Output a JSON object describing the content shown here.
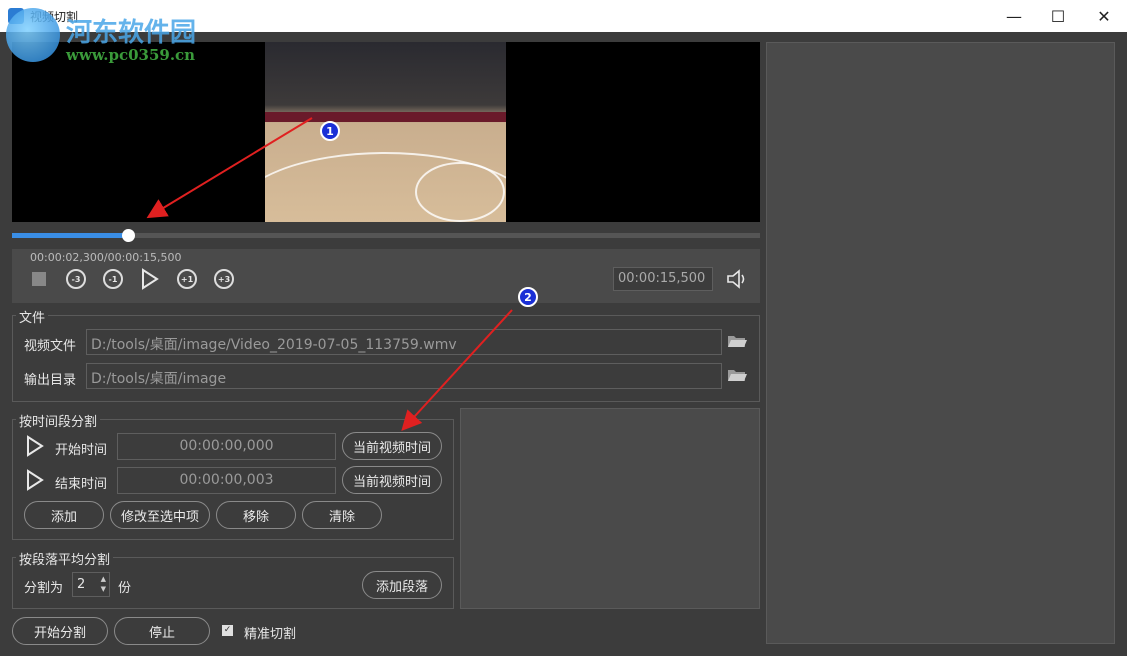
{
  "window": {
    "title": "视频切割",
    "watermark_name": "河东软件园",
    "watermark_url": "www.pc0359.cn",
    "minimize": "—",
    "maximize": "☐",
    "close": "✕"
  },
  "player": {
    "time_position": "00:00:02,300/00:00:15,500",
    "progress_fraction": 0.155,
    "time_field": "00:00:15,500",
    "skip_back_3": "-3",
    "skip_back_1": "-1",
    "skip_fwd_1": "+1",
    "skip_fwd_3": "+3"
  },
  "annotations": {
    "marker_1": "1",
    "marker_2": "2"
  },
  "file_group": {
    "title": "文件",
    "video_label": "视频文件",
    "video_path": "D:/tools/桌面/image/Video_2019-07-05_113759.wmv",
    "output_label": "输出目录",
    "output_path": "D:/tools/桌面/image"
  },
  "time_split": {
    "title": "按时间段分割",
    "start_label": "开始时间",
    "start_value": "00:00:00,000",
    "end_label": "结束时间",
    "end_value": "00:00:00,003",
    "current_time_btn": "当前视频时间",
    "add_btn": "添加",
    "modify_btn": "修改至选中项",
    "remove_btn": "移除",
    "clear_btn": "清除"
  },
  "avg_split": {
    "title": "按段落平均分割",
    "split_label": "分割为",
    "count": "2",
    "unit": "份",
    "add_btn": "添加段落"
  },
  "footer": {
    "start_btn": "开始分割",
    "stop_btn": "停止",
    "precise_label": "精准切割",
    "precise_checked": true
  },
  "colors": {
    "accent": "#3a8ee6",
    "arrow": "#e02020",
    "badge": "#1a2fd6"
  }
}
